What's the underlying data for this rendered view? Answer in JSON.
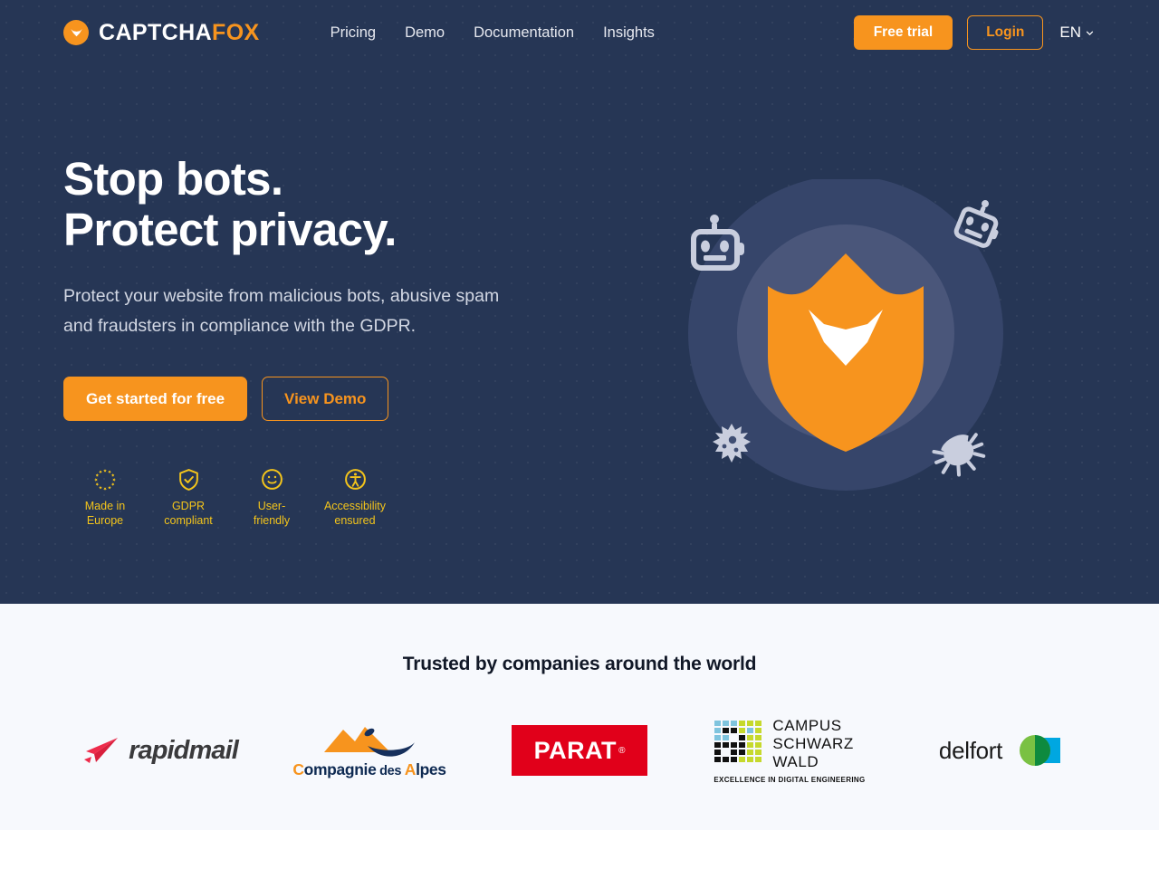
{
  "brand": {
    "name_primary": "CAPTCHA",
    "name_accent": "FOX",
    "mark_icon": "fox-logo-icon",
    "accent_color": "#F7941E"
  },
  "nav": {
    "links": [
      {
        "label": "Pricing"
      },
      {
        "label": "Demo"
      },
      {
        "label": "Documentation"
      },
      {
        "label": "Insights"
      }
    ],
    "free_trial_label": "Free trial",
    "login_label": "Login",
    "language": "EN",
    "language_chevron": "chevron-down-icon"
  },
  "hero": {
    "headline_line1": "Stop bots.",
    "headline_line2": "Protect privacy.",
    "subtitle": "Protect your website from malicious bots, abusive spam and fraudsters in compliance with the GDPR.",
    "cta_primary": "Get started for free",
    "cta_secondary": "View Demo",
    "badges": [
      {
        "icon": "eu-stars-icon",
        "label": "Made in\nEurope"
      },
      {
        "icon": "shield-check-icon",
        "label": "GDPR\ncompliant"
      },
      {
        "icon": "smiley-face-icon",
        "label": "User-\nfriendly"
      },
      {
        "icon": "accessibility-icon",
        "label": "Accessibility\nensured"
      }
    ],
    "badge_color": "#F3C41B",
    "illustration": {
      "shield_color": "#F7941E",
      "fox_color": "#FFFFFF",
      "threat_icons": [
        "robot-head-icon",
        "robot-head-tilted-icon",
        "virus-icon",
        "bug-icon"
      ]
    }
  },
  "trusted": {
    "title": "Trusted by companies around the world",
    "logos": [
      {
        "name": "rapidmail",
        "text": "rapidmail",
        "icon": "paper-plane-icon",
        "color": "#EE2B4B"
      },
      {
        "name": "compagnie-des-alpes",
        "text": "Compagnie des Alpes",
        "icon": "mountain-icon",
        "color": "#F7941E"
      },
      {
        "name": "parat",
        "text": "PARAT",
        "registered": "®",
        "color": "#E1001A"
      },
      {
        "name": "campus-schwarzwald",
        "text": "CAMPUS\nSCHWARZ\nWALD",
        "tagline": "EXCELLENCE IN DIGITAL ENGINEERING",
        "icon": "pixel-grid-icon"
      },
      {
        "name": "delfort",
        "text": "delfort",
        "icon": "circle-square-icon",
        "colors": [
          "#7AC143",
          "#0E8A3E",
          "#00A7E1"
        ]
      }
    ]
  }
}
